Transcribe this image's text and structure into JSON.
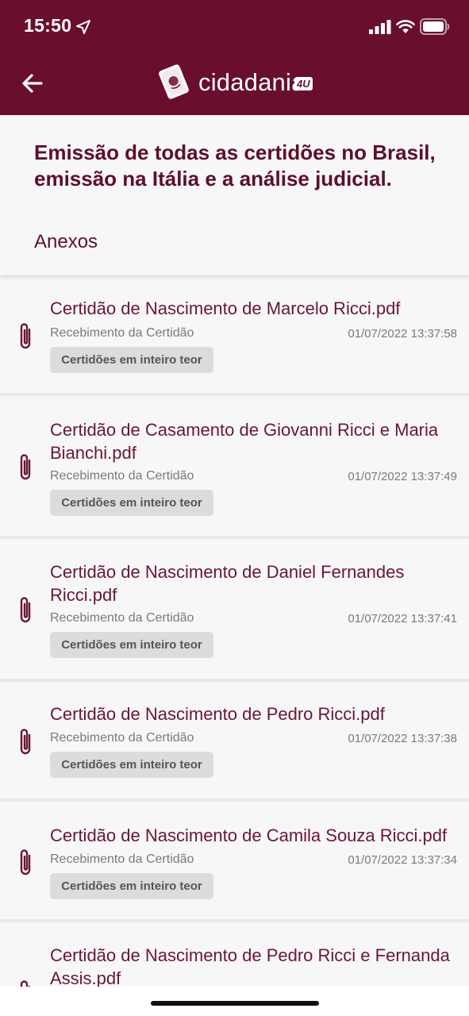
{
  "status_bar": {
    "time": "15:50"
  },
  "app": {
    "brand_name": "cidadania",
    "brand_badge": "4U",
    "accent": "#690f2c"
  },
  "header": {
    "title": "Emissão de todas as certidões no Brasil, emissão na Itália e a análise judicial.",
    "subtitle": "Anexos"
  },
  "attachments": [
    {
      "file_name": "Certidão de Nascimento de Marcelo Ricci.pdf",
      "label": "Recebimento da Certidão",
      "date": "01/07/2022 13:37:58",
      "tag": "Certidões em inteiro teor"
    },
    {
      "file_name": "Certidão de Casamento de Giovanni Ricci e Maria Bianchi.pdf",
      "label": "Recebimento da Certidão",
      "date": "01/07/2022 13:37:49",
      "tag": "Certidões em inteiro teor"
    },
    {
      "file_name": "Certidão de Nascimento de Daniel Fernandes Ricci.pdf",
      "label": "Recebimento da Certidão",
      "date": "01/07/2022 13:37:41",
      "tag": "Certidões em inteiro teor"
    },
    {
      "file_name": "Certidão de Nascimento de Pedro Ricci.pdf",
      "label": "Recebimento da Certidão",
      "date": "01/07/2022 13:37:38",
      "tag": "Certidões em inteiro teor"
    },
    {
      "file_name": "Certidão de Nascimento de Camila Souza Ricci.pdf",
      "label": "Recebimento da Certidão",
      "date": "01/07/2022 13:37:34",
      "tag": "Certidões em inteiro teor"
    },
    {
      "file_name": "Certidão de Nascimento de Pedro Ricci e Fernanda Assis.pdf"
    }
  ]
}
